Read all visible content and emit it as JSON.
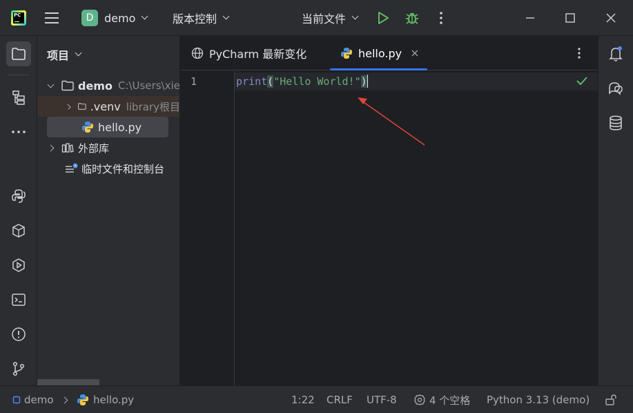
{
  "titlebar": {
    "logo_text": "PC",
    "project_badge": "D",
    "project_name": "demo",
    "vcs_label": "版本控制",
    "run_config": "当前文件"
  },
  "project_panel": {
    "title": "项目",
    "tree": [
      {
        "label": "demo",
        "hint": "C:\\Users\\xie"
      },
      {
        "label": ".venv",
        "hint": "library根目"
      },
      {
        "label": "hello.py",
        "hint": ""
      },
      {
        "label": "外部库",
        "hint": ""
      },
      {
        "label": "临时文件和控制台",
        "hint": ""
      }
    ]
  },
  "editor": {
    "tabs": [
      {
        "label": "PyCharm 最新变化"
      },
      {
        "label": "hello.py"
      }
    ],
    "line_number": "1",
    "code": {
      "func": "print",
      "open_paren": "(",
      "string": "\"Hello World!\"",
      "close_paren": ")"
    }
  },
  "statusbar": {
    "breadcrumb_project": "demo",
    "breadcrumb_file": "hello.py",
    "position": "1:22",
    "line_sep": "CRLF",
    "encoding": "UTF-8",
    "indent": "4 个空格",
    "interpreter": "Python 3.13 (demo)"
  },
  "colors": {
    "accent": "#3574f0",
    "badge": "#5fb38b",
    "run_green": "#5fb865",
    "annotation_red": "#e0443a"
  }
}
